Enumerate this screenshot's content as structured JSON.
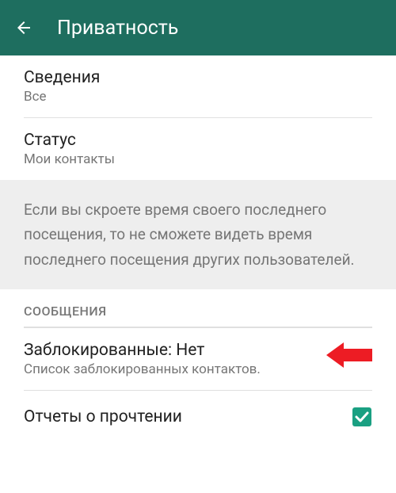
{
  "header": {
    "title": "Приватность"
  },
  "items": [
    {
      "title": "Сведения",
      "subtitle": "Все"
    },
    {
      "title": "Статус",
      "subtitle": "Мои контакты"
    }
  ],
  "note": "Если вы скроете время своего последнего посещения, то не сможете видеть время последнего посещения других пользователей.",
  "section_header": "СООБЩЕНИЯ",
  "blocked": {
    "title": "Заблокированные: Нет",
    "subtitle": "Список заблокированных контактов."
  },
  "read_receipts": {
    "label": "Отчеты о прочтении",
    "checked": true
  },
  "colors": {
    "header_bg": "#1e6e5f",
    "accent": "#1aa082",
    "pointer": "#ed1c24"
  }
}
